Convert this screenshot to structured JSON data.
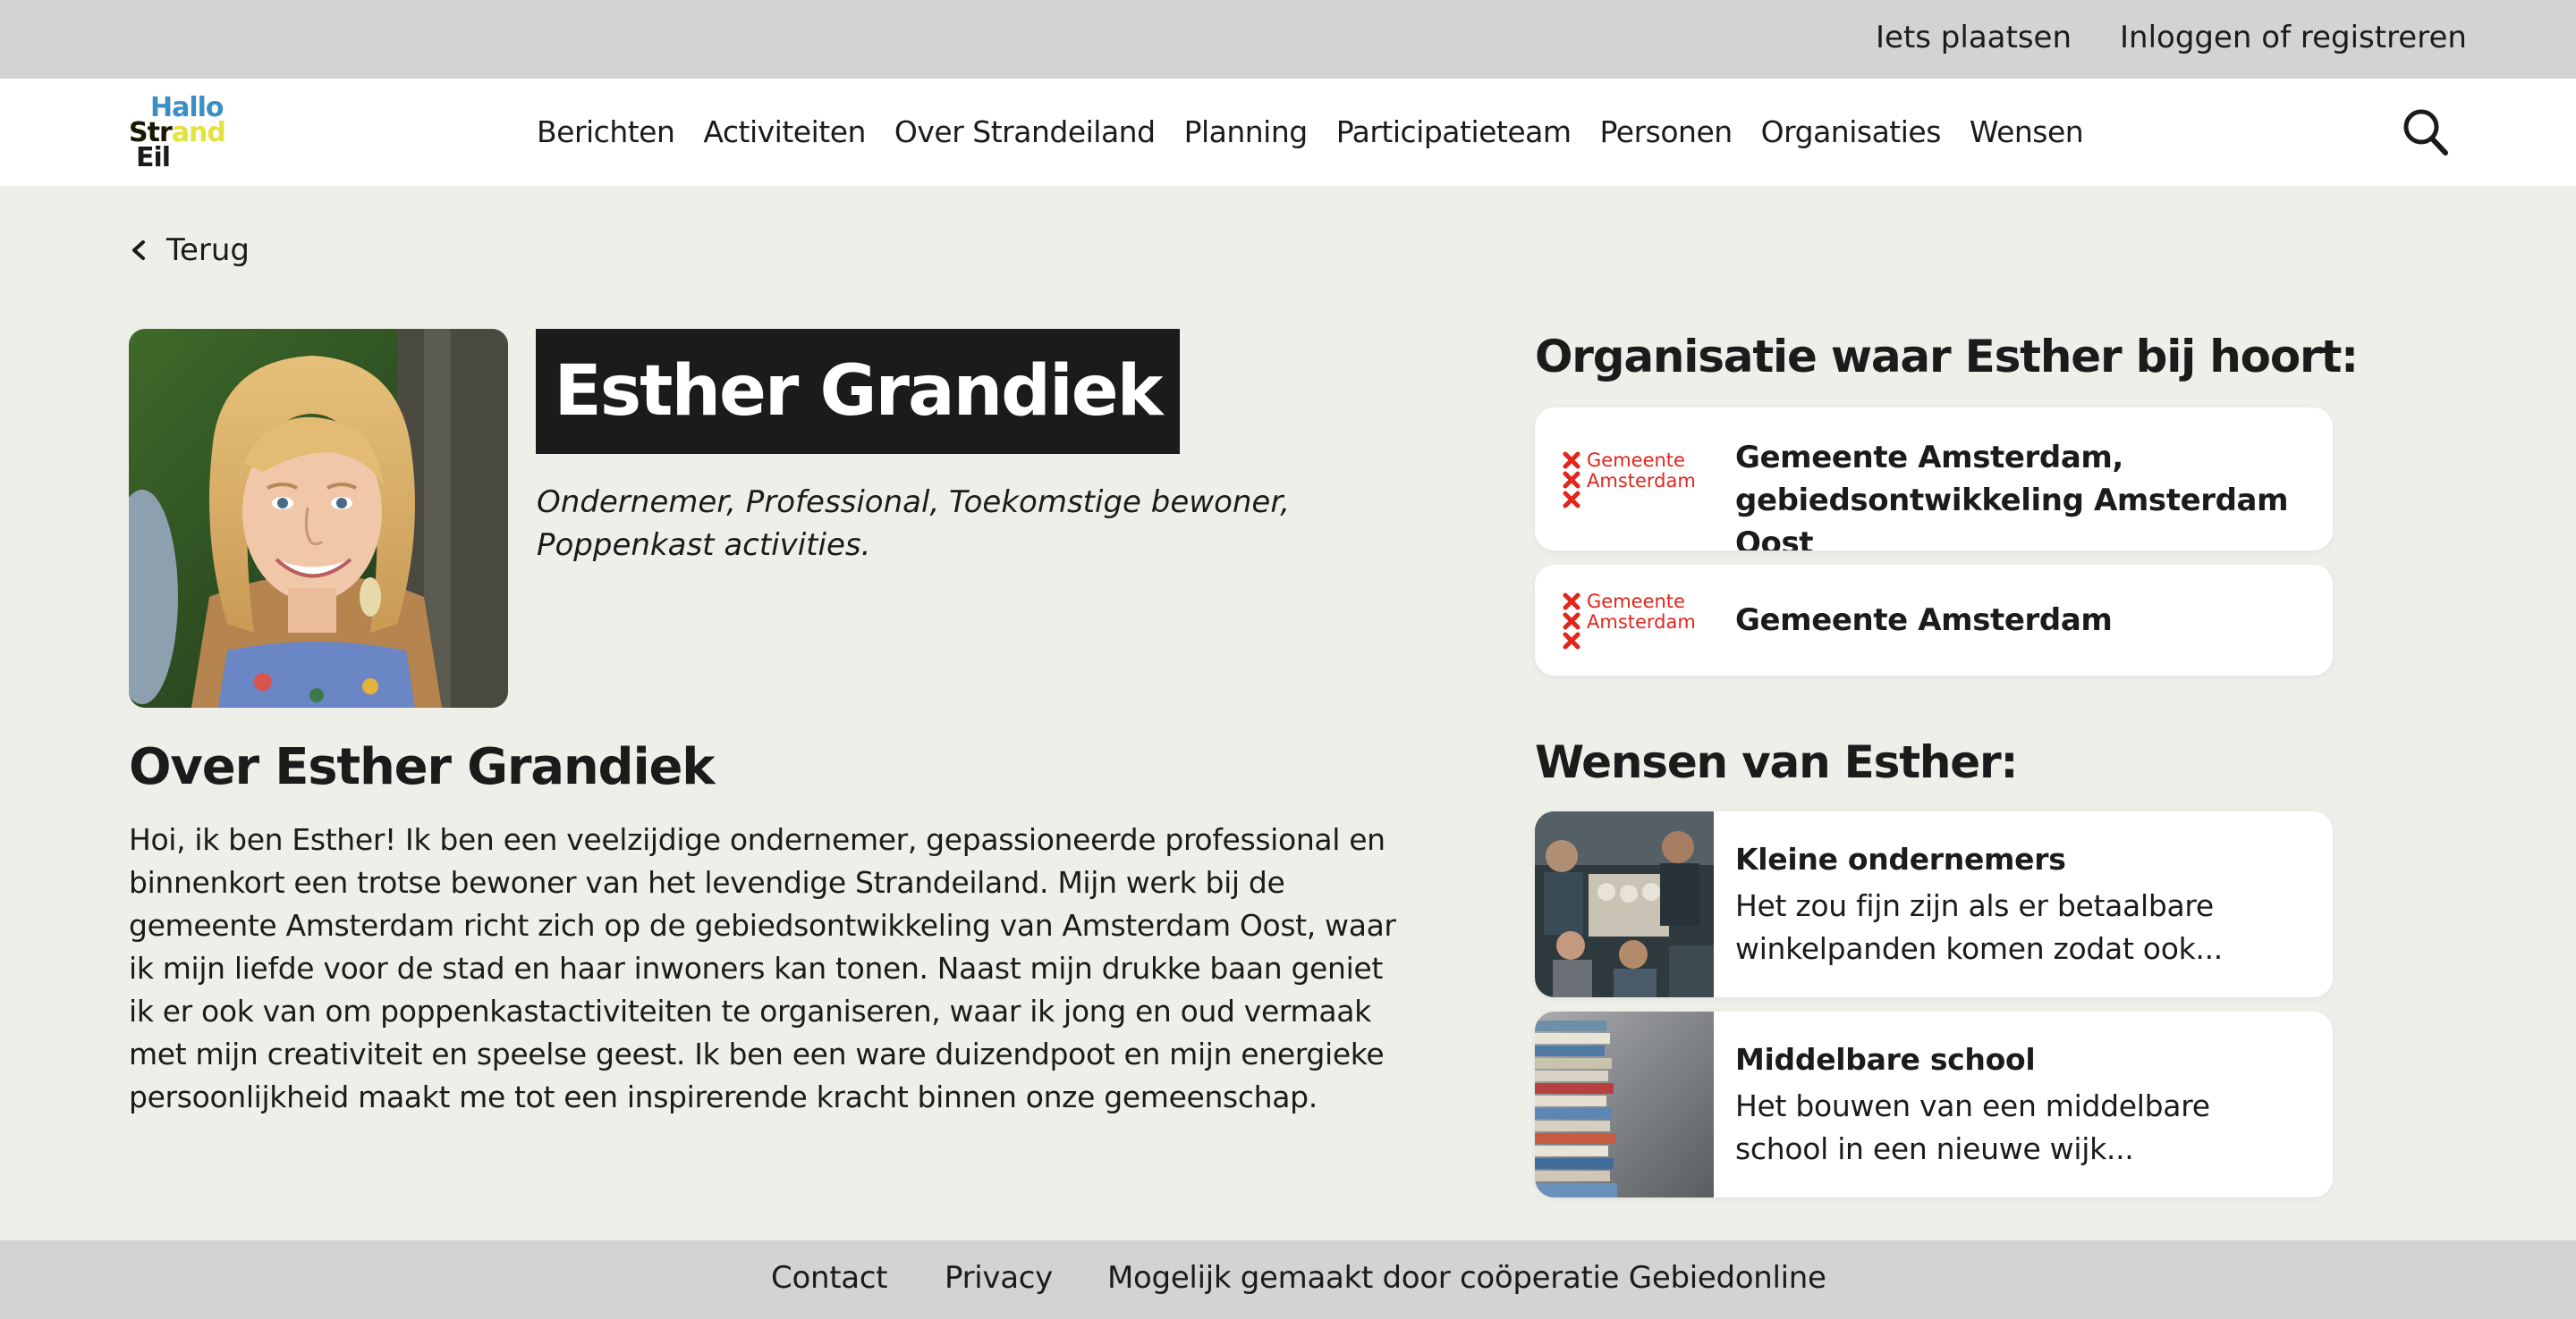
{
  "topbar": {
    "post_label": "Iets plaatsen",
    "login_label": "Inloggen of registreren"
  },
  "logo": {
    "line1": "Hallo",
    "line2": "Strand",
    "line3": "Eil",
    "colors": {
      "hallo": "#3b8fc4",
      "strand": "#e3e23a",
      "text": "#1b1b1b"
    }
  },
  "nav": {
    "items": [
      {
        "label": "Berichten"
      },
      {
        "label": "Activiteiten"
      },
      {
        "label": "Over Strandeiland"
      },
      {
        "label": "Planning"
      },
      {
        "label": "Participatieteam"
      },
      {
        "label": "Personen"
      },
      {
        "label": "Organisaties"
      },
      {
        "label": "Wensen"
      }
    ],
    "search_icon": "search-icon"
  },
  "back": {
    "label": "Terug",
    "icon": "chevron-left-icon"
  },
  "profile": {
    "name": "Esther Grandiek",
    "roles": "Ondernemer, Professional, Toekomstige bewoner, Poppenkast activities.",
    "about_title": "Over Esther Grandiek",
    "about_text": "Hoi, ik ben Esther! Ik ben een veelzijdige ondernemer, gepassioneerde professional en binnenkort een trotse bewoner van het levendige Strandeiland. Mijn werk bij de gemeente Amsterdam richt zich op de gebiedsontwikkeling van Amsterdam Oost, waar ik mijn liefde voor de stad en haar inwoners kan tonen. Naast mijn drukke baan geniet ik er ook van om poppenkastactiviteiten te organiseren, waar ik jong en oud vermaak met mijn creativiteit en speelse geest. Ik ben een ware duizendpoot en mijn energieke persoonlijkheid maakt me tot een inspirerende kracht binnen onze gemeenschap."
  },
  "organisations": {
    "title": "Organisatie waar Esther bij hoort:",
    "logo_text": [
      "Gemeente",
      "Amsterdam"
    ],
    "logo_color": "#e1261c",
    "items": [
      {
        "name": "Gemeente Amsterdam, gebiedsontwikkeling Amsterdam Oost"
      },
      {
        "name": "Gemeente Amsterdam"
      }
    ]
  },
  "wishes": {
    "title": "Wensen van Esther:",
    "items": [
      {
        "title": "Kleine ondernemers",
        "description": "Het zou fijn zijn als er betaalbare winkelpanden komen zodat ook..."
      },
      {
        "title": "Middelbare school",
        "description": "Het bouwen van een middelbare school in een nieuwe wijk..."
      }
    ]
  },
  "footer": {
    "contact": "Contact",
    "privacy": "Privacy",
    "credit": "Mogelijk gemaakt door coöperatie Gebiedonline"
  },
  "colors": {
    "page_bg": "#efefea",
    "bar_bg": "#d3d3d3",
    "name_box_bg": "#1b1b1b",
    "card_bg": "#ffffff"
  }
}
